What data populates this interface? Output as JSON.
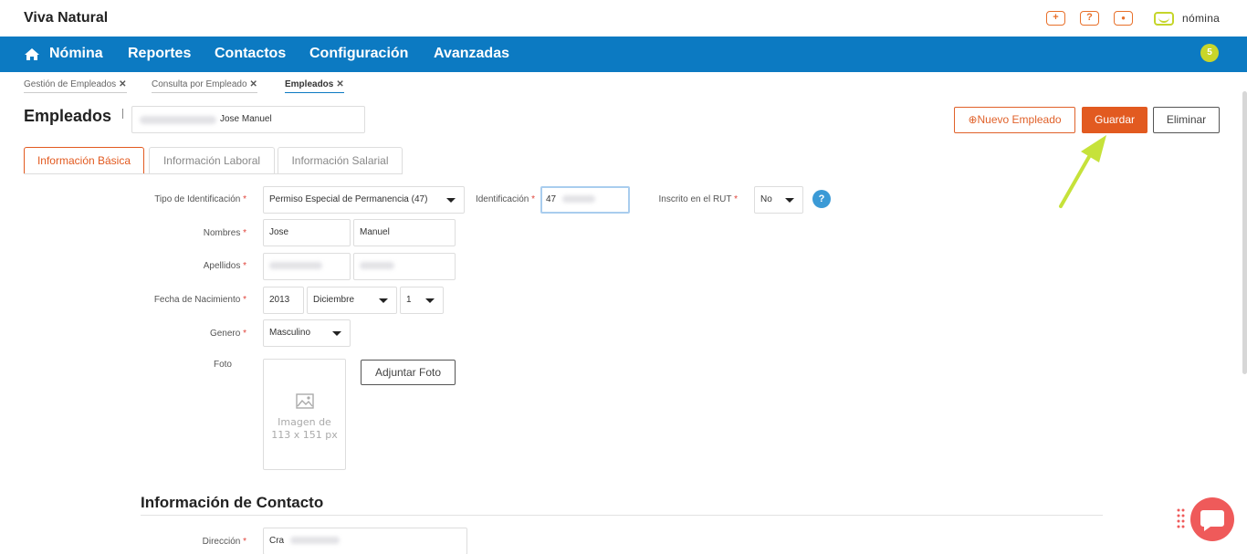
{
  "app": {
    "brand": "Viva Natural",
    "product": "nómina",
    "top_icons": [
      "plus-icon",
      "help-icon",
      "user-icon"
    ],
    "notification_count": "5",
    "colors": {
      "nav": "#0c7ac2",
      "accent": "#e25a20",
      "badge": "#c9d62a",
      "chat": "#ef5a5a"
    }
  },
  "nav": {
    "items": [
      "Nómina",
      "Reportes",
      "Contactos",
      "Configuración",
      "Avanzadas"
    ]
  },
  "breadcrumbs": [
    {
      "label": "Gestión de Empleados"
    },
    {
      "label": "Consulta por Empleado"
    },
    {
      "label": "Empleados"
    }
  ],
  "header": {
    "title": "Empleados",
    "employee_name": "Jose Manuel",
    "buttons": {
      "new": "⊕Nuevo Empleado",
      "save": "Guardar",
      "delete": "Eliminar"
    }
  },
  "tabs": [
    "Información Básica",
    "Información Laboral",
    "Información Salarial"
  ],
  "form": {
    "id_type": {
      "label": "Tipo de Identificación",
      "value": "Permiso Especial de Permanencia (47)"
    },
    "id_number": {
      "label": "Identificación",
      "value": "47"
    },
    "rut": {
      "label": "Inscrito en el RUT",
      "value": "No"
    },
    "names": {
      "label": "Nombres",
      "first": "Jose",
      "second": "Manuel"
    },
    "surnames": {
      "label": "Apellidos"
    },
    "birth": {
      "label": "Fecha de Nacimiento",
      "year": "2013",
      "month": "Diciembre",
      "day": "1"
    },
    "gender": {
      "label": "Genero",
      "value": "Masculino"
    },
    "photo": {
      "label": "Foto",
      "placeholder_line1": "Imagen de",
      "placeholder_line2": "113 x 151 px",
      "button": "Adjuntar Foto"
    }
  },
  "contact": {
    "title": "Información de Contacto",
    "address": {
      "label": "Dirección",
      "value": "Cra"
    }
  },
  "help_symbol": "?"
}
